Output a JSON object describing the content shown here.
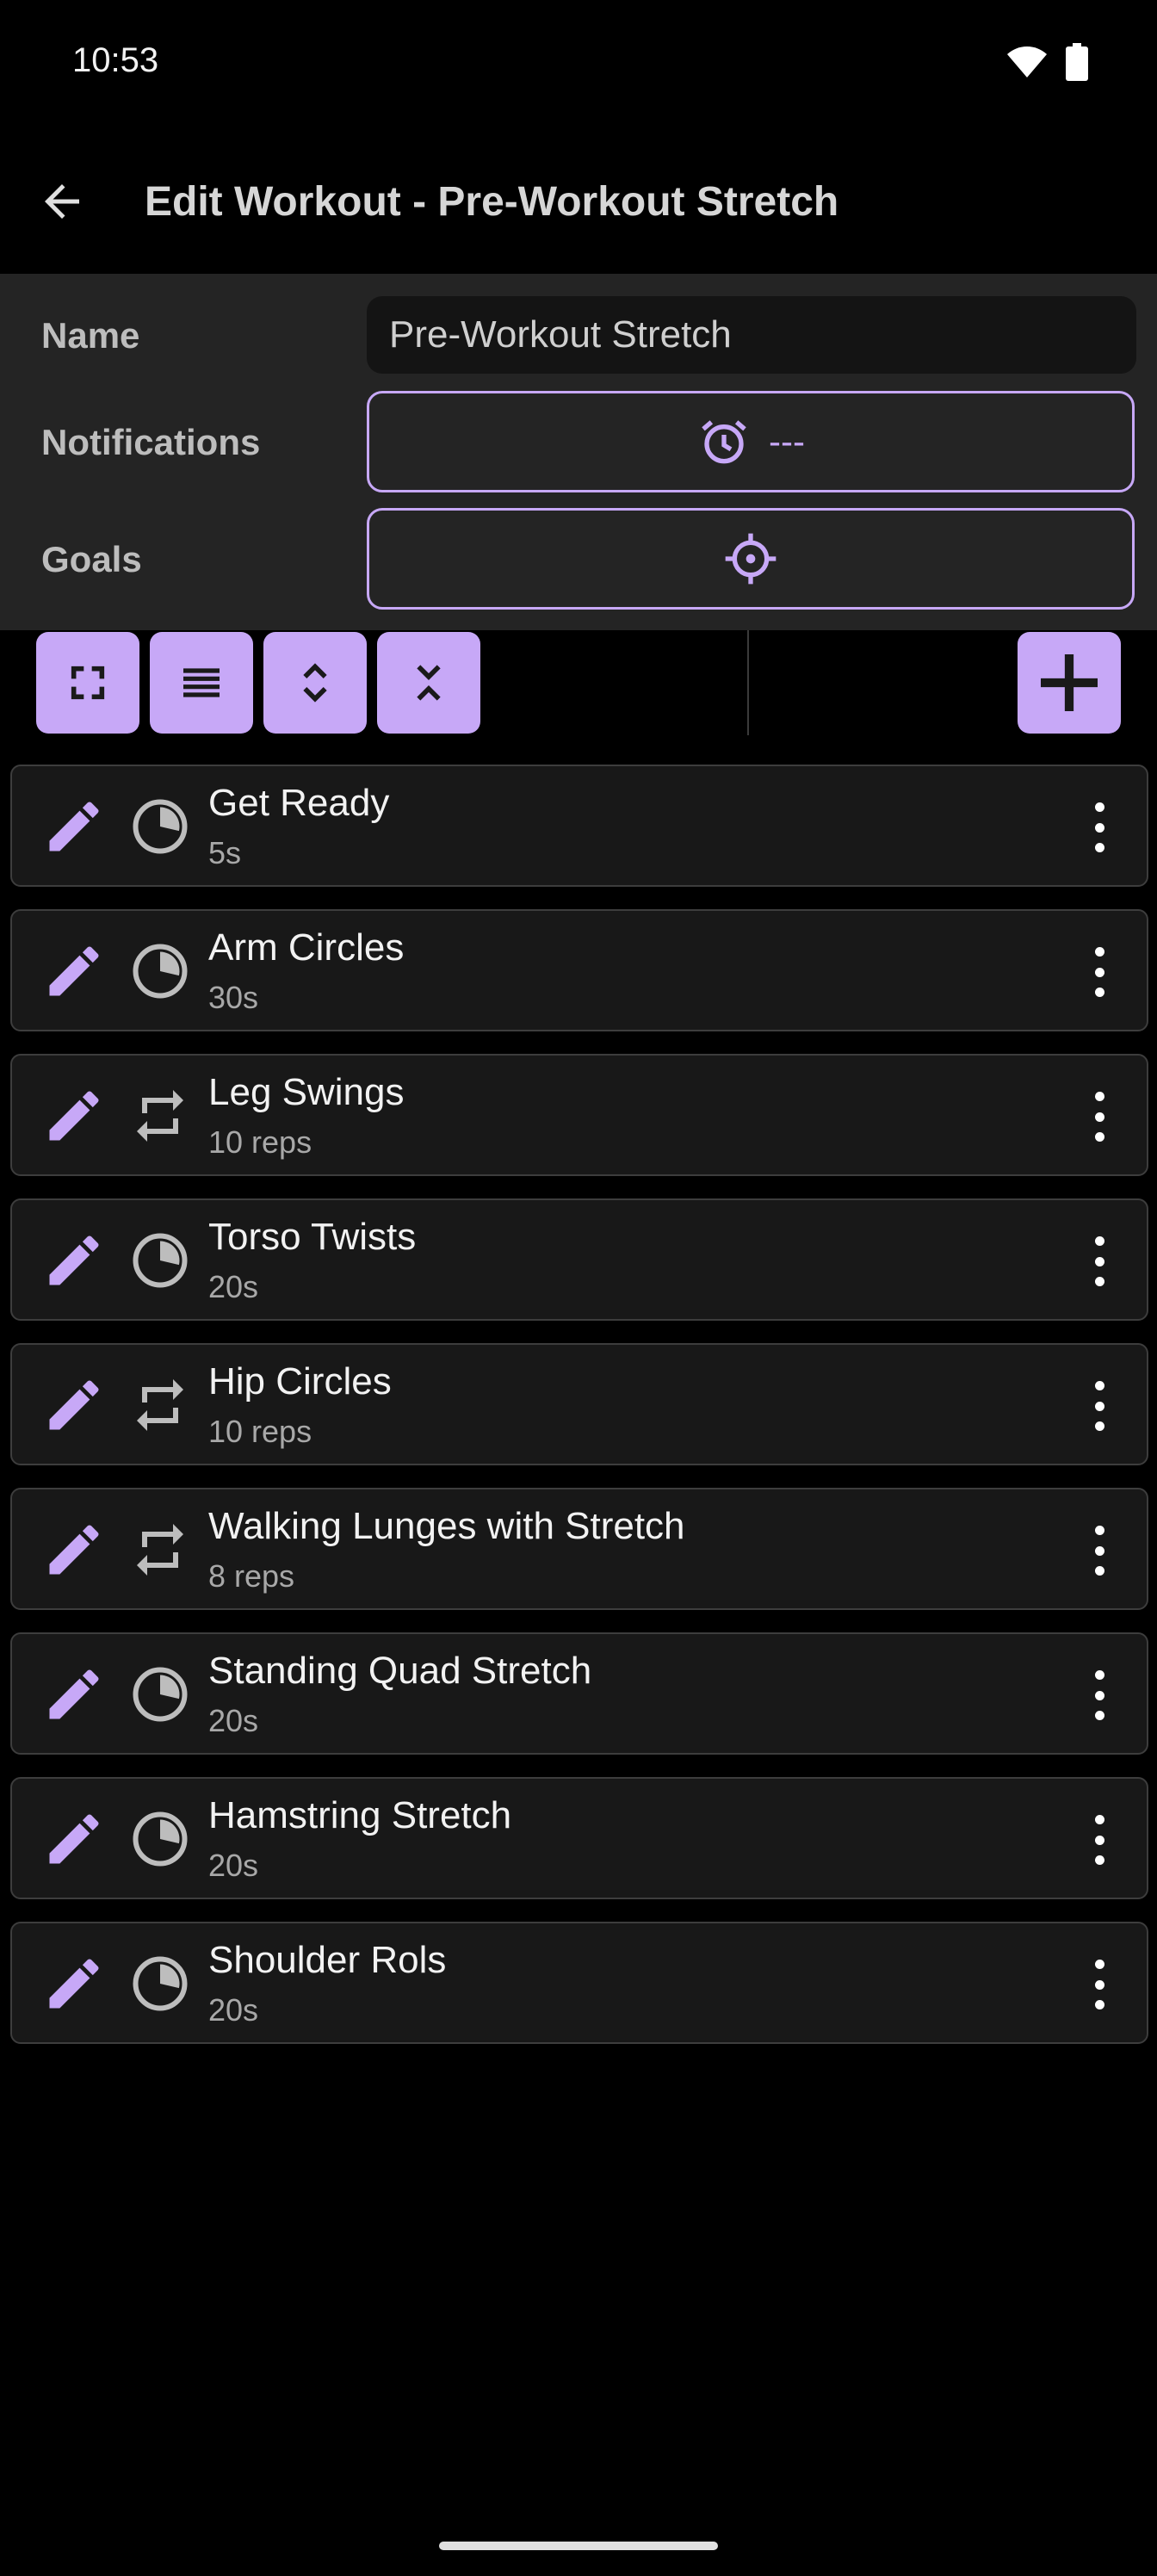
{
  "status_bar": {
    "time": "10:53"
  },
  "app_bar": {
    "title": "Edit Workout - Pre-Workout Stretch"
  },
  "form": {
    "name_label": "Name",
    "name_value": "Pre-Workout Stretch",
    "notifications_label": "Notifications",
    "notifications_value": "---",
    "goals_label": "Goals"
  },
  "toolbar": {
    "buttons": [
      "fullscreen-icon",
      "list-icon",
      "expand-icon",
      "collapse-icon"
    ],
    "add": "add-icon"
  },
  "exercises": [
    {
      "name": "Get Ready",
      "detail": "5s",
      "type": "timer"
    },
    {
      "name": "Arm Circles",
      "detail": "30s",
      "type": "timer"
    },
    {
      "name": "Leg Swings",
      "detail": "10 reps",
      "type": "reps"
    },
    {
      "name": "Torso Twists",
      "detail": "20s",
      "type": "timer"
    },
    {
      "name": "Hip Circles",
      "detail": "10 reps",
      "type": "reps"
    },
    {
      "name": "Walking Lunges with Stretch",
      "detail": "8 reps",
      "type": "reps"
    },
    {
      "name": "Standing Quad Stretch",
      "detail": "20s",
      "type": "timer"
    },
    {
      "name": "Hamstring Stretch",
      "detail": "20s",
      "type": "timer"
    },
    {
      "name": "Shoulder Rols",
      "detail": "20s",
      "type": "timer"
    }
  ],
  "colors": {
    "accent": "#c7a8f7",
    "background": "#000000",
    "panel": "#242424",
    "card": "#181818"
  }
}
